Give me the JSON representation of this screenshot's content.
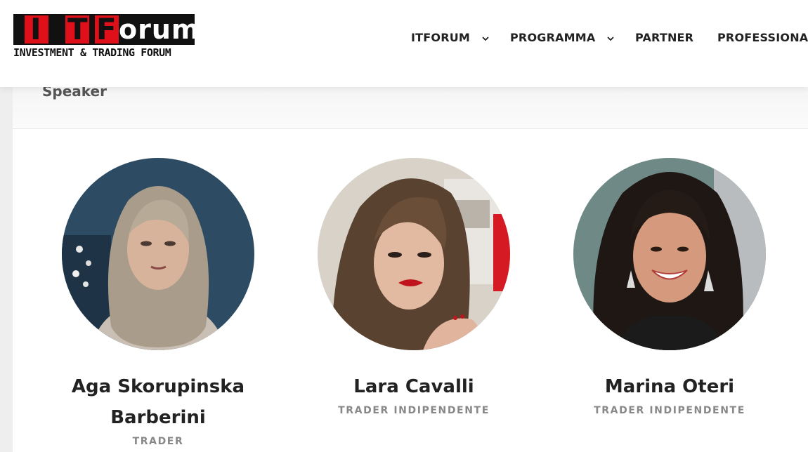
{
  "brand": {
    "logo_letters": [
      "I",
      "T",
      "F",
      "orum"
    ],
    "tagline": "INVESTMENT & TRADING FORUM",
    "accent_red": "#e0101b",
    "logo_black": "#111111"
  },
  "nav": {
    "items": [
      {
        "label": "ITFORUM",
        "has_dropdown": true,
        "icon": "chevron-down-icon"
      },
      {
        "label": "PROGRAMMA",
        "has_dropdown": true,
        "icon": "chevron-down-icon"
      },
      {
        "label": "PARTNER",
        "has_dropdown": false
      },
      {
        "label": "PROFESSIONAL",
        "has_dropdown": false
      }
    ]
  },
  "breadcrumb": {
    "title": "Speaker"
  },
  "speakers": [
    {
      "name_line1": "Aga Skorupinska",
      "name_line2": "Barberini",
      "role": "TRADER"
    },
    {
      "name_line1": "Lara Cavalli",
      "name_line2": "",
      "role": "TRADER INDIPENDENTE"
    },
    {
      "name_line1": "Marina Oteri",
      "name_line2": "",
      "role": "TRADER INDIPENDENTE"
    }
  ]
}
